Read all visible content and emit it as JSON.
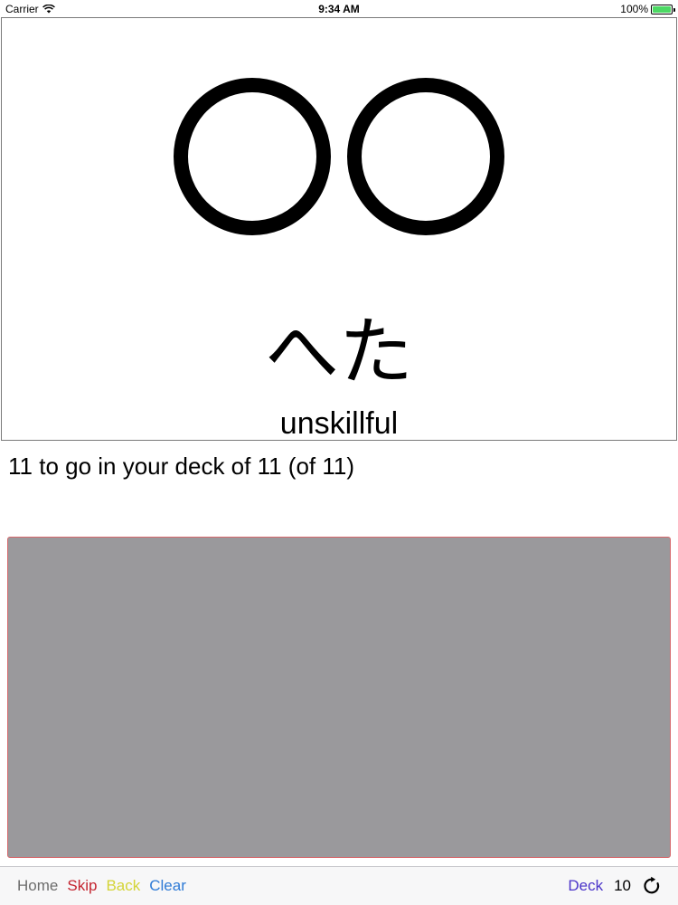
{
  "status_bar": {
    "carrier": "Carrier",
    "time": "9:34 AM",
    "battery": "100%",
    "icons": [
      "wifi-icon",
      "battery-icon"
    ]
  },
  "card": {
    "illustration": "two-circles",
    "kana": "へた",
    "meaning": "unskillful"
  },
  "progress": {
    "text": "11 to go in your deck of 11 (of 11)"
  },
  "drawing_pad": {
    "background_color": "#9a999c",
    "border_color": "#d6686c"
  },
  "toolbar": {
    "home_label": "Home",
    "skip_label": "Skip",
    "back_label": "Back",
    "clear_label": "Clear",
    "deck_label": "Deck",
    "count": "10",
    "refresh_icon": "refresh-icon",
    "colors": {
      "home": "#6d6d6d",
      "skip": "#c4242f",
      "back": "#d4d436",
      "clear": "#2f7bd6",
      "deck": "#4a33c9"
    }
  }
}
